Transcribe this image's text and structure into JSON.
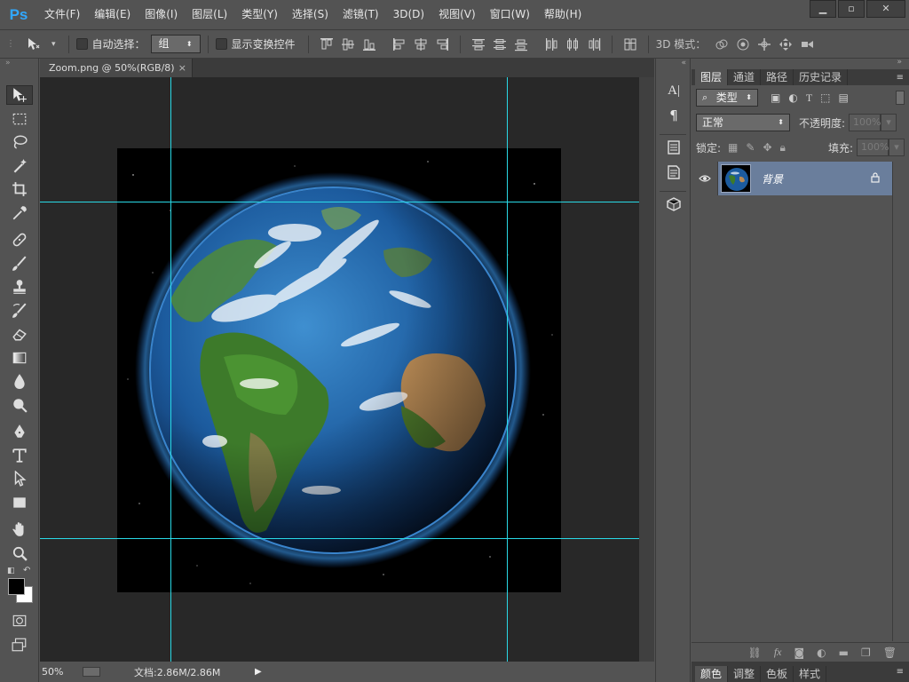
{
  "app": {
    "logo": "Ps"
  },
  "menu": [
    "文件(F)",
    "编辑(E)",
    "图像(I)",
    "图层(L)",
    "类型(Y)",
    "选择(S)",
    "滤镜(T)",
    "3D(D)",
    "视图(V)",
    "窗口(W)",
    "帮助(H)"
  ],
  "options": {
    "auto_select_label": "自动选择：",
    "auto_select_value": "组",
    "transform_label": "显示变换控件",
    "mode3d_label": "3D 模式："
  },
  "document": {
    "tab_title": "Zoom.png @ 50%(RGB/8)",
    "tab_close": "×",
    "zoom": "50%",
    "doc_info": "文档:2.86M/2.86M"
  },
  "panel": {
    "tabs": [
      "图层",
      "通道",
      "路径",
      "历史记录"
    ],
    "filter_kind": "类型",
    "blend_mode": "正常",
    "opacity_label": "不透明度:",
    "opacity_value": "100%",
    "lock_label": "锁定:",
    "fill_label": "填充:",
    "fill_value": "100%",
    "layer_name": "背景",
    "bottom_tabs": [
      "颜色",
      "调整",
      "色板",
      "样式"
    ],
    "bottom_icons": [
      "link-icon",
      "fx-icon",
      "mask-icon",
      "adjustment-icon",
      "folder-icon",
      "new-layer-icon",
      "trash-icon"
    ]
  },
  "colors": {
    "guide": "#29d9e6",
    "layer_selected": "#6a7e9c",
    "ps_blue": "#31a8ff"
  }
}
